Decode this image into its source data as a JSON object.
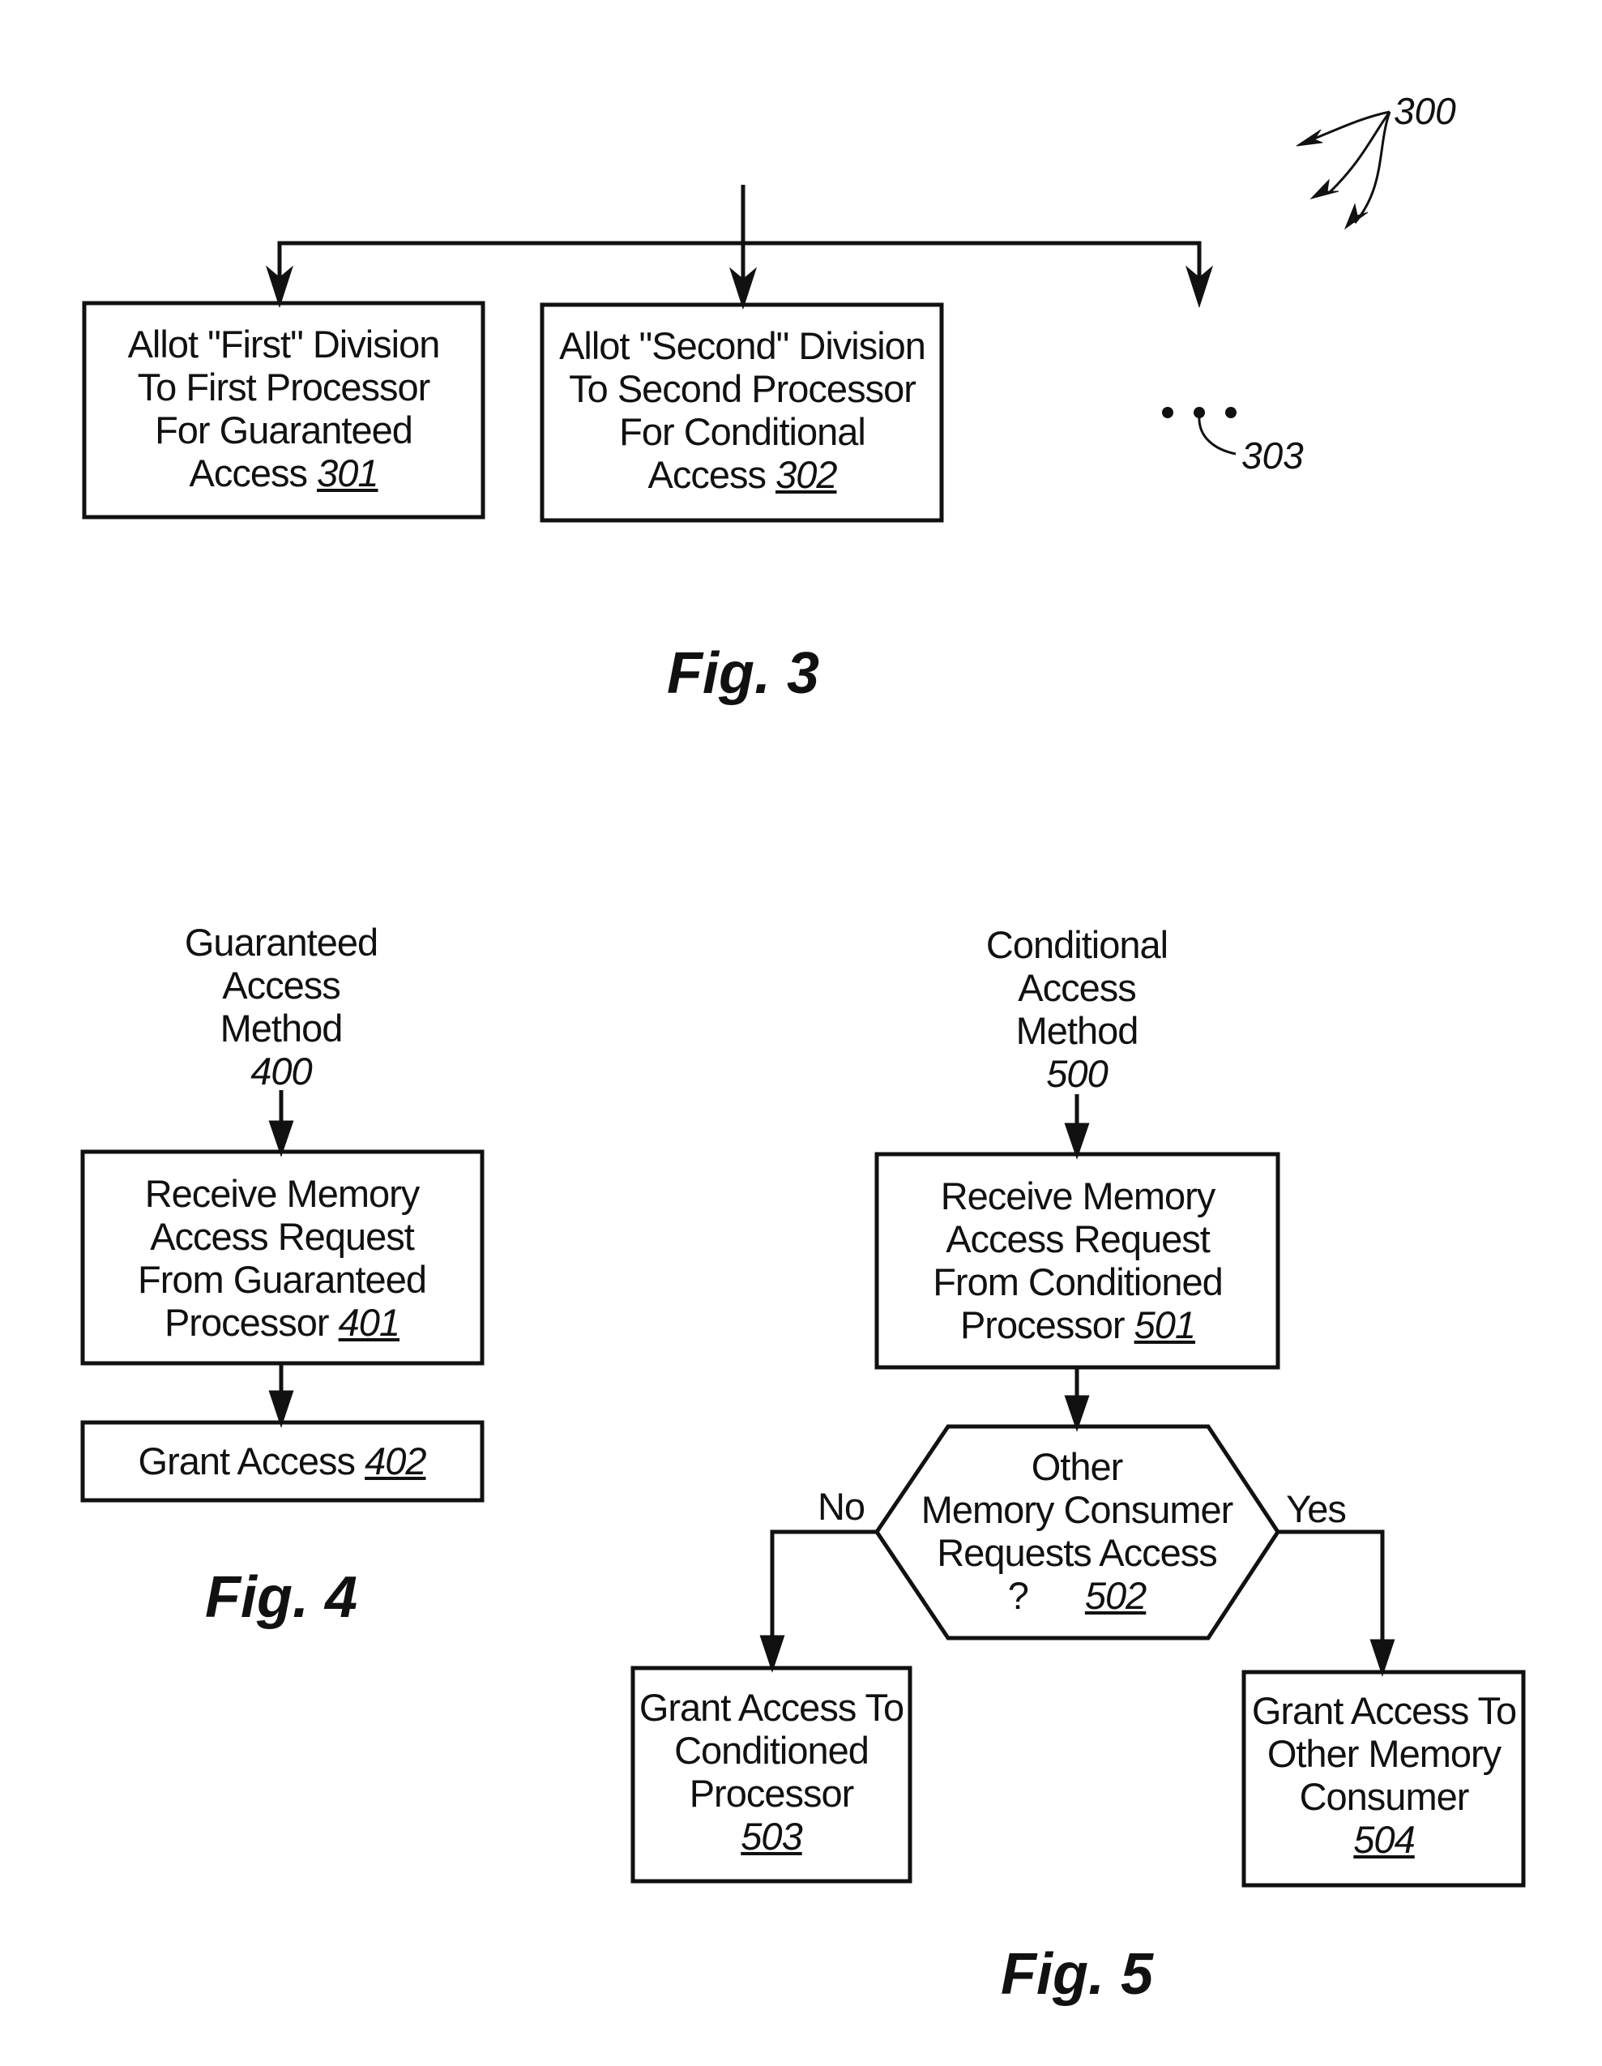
{
  "fig3": {
    "caption": "Fig. 3",
    "ref_number": "300",
    "continuation_ref": "303",
    "boxes": [
      {
        "lines": [
          "Allot \"First\" Division",
          "To First Processor",
          "For Guaranteed",
          "Access"
        ],
        "ref": "301"
      },
      {
        "lines": [
          "Allot \"Second\" Division",
          "To Second Processor",
          "For Conditional",
          "Access"
        ],
        "ref": "302"
      }
    ]
  },
  "fig4": {
    "caption": "Fig. 4",
    "title_lines": [
      "Guaranteed",
      "Access",
      "Method"
    ],
    "ref": "400",
    "boxes": [
      {
        "lines": [
          "Receive Memory",
          "Access Request",
          "From Guaranteed",
          "Processor"
        ],
        "ref": "401"
      },
      {
        "lines": [
          "Grant Access"
        ],
        "ref": "402"
      }
    ]
  },
  "fig5": {
    "caption": "Fig. 5",
    "title_lines": [
      "Conditional",
      "Access",
      "Method"
    ],
    "ref": "500",
    "boxes": [
      {
        "lines": [
          "Receive Memory",
          "Access Request",
          "From Conditioned",
          "Processor"
        ],
        "ref": "501"
      },
      {
        "lines": [
          "Grant Access To",
          "Conditioned",
          "Processor"
        ],
        "ref": "503"
      },
      {
        "lines": [
          "Grant Access To",
          "Other Memory",
          "Consumer"
        ],
        "ref": "504"
      }
    ],
    "decision": {
      "lines": [
        "Other",
        "Memory Consumer",
        "Requests Access"
      ],
      "question": "?",
      "ref": "502"
    },
    "branch_no": "No",
    "branch_yes": "Yes"
  }
}
